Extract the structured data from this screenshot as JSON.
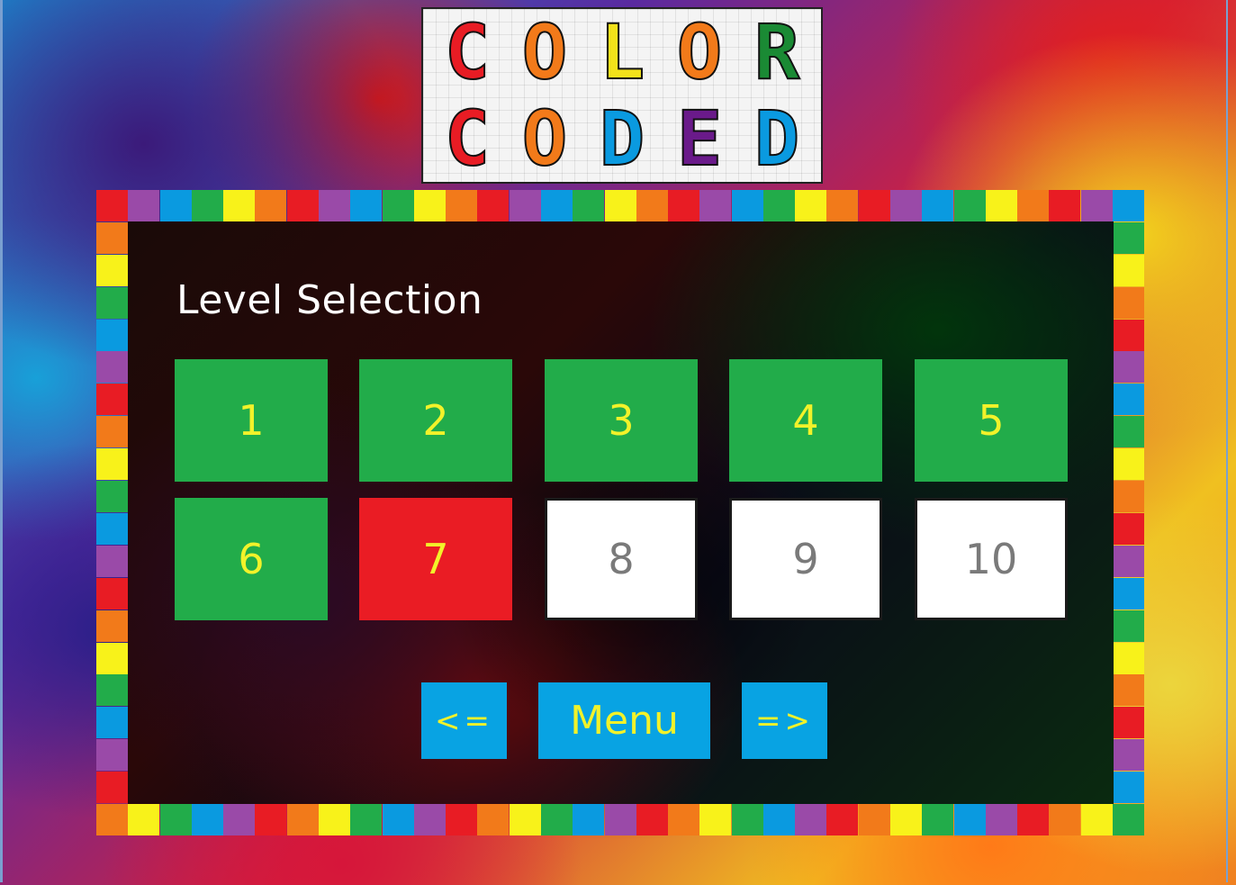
{
  "logo": {
    "row1": [
      {
        "letter": "C",
        "color": "#e81c24"
      },
      {
        "letter": "O",
        "color": "#f27a1a"
      },
      {
        "letter": "L",
        "color": "#f2e21a"
      },
      {
        "letter": "O",
        "color": "#f27a1a"
      },
      {
        "letter": "R",
        "color": "#1a8a34"
      }
    ],
    "row2": [
      {
        "letter": "C",
        "color": "#e81c24"
      },
      {
        "letter": "O",
        "color": "#f27a1a"
      },
      {
        "letter": "D",
        "color": "#0a9ae0"
      },
      {
        "letter": "E",
        "color": "#6a1a8a"
      },
      {
        "letter": "D",
        "color": "#0a9ae0"
      }
    ]
  },
  "panel": {
    "title": "Level Selection"
  },
  "levels": [
    {
      "label": "1",
      "status": "completed"
    },
    {
      "label": "2",
      "status": "completed"
    },
    {
      "label": "3",
      "status": "completed"
    },
    {
      "label": "4",
      "status": "completed"
    },
    {
      "label": "5",
      "status": "completed"
    },
    {
      "label": "6",
      "status": "completed"
    },
    {
      "label": "7",
      "status": "current"
    },
    {
      "label": "8",
      "status": "locked"
    },
    {
      "label": "9",
      "status": "locked"
    },
    {
      "label": "10",
      "status": "locked"
    }
  ],
  "nav": {
    "prev_label": "<=",
    "menu_label": "Menu",
    "next_label": "=>"
  },
  "colors": {
    "completed": "#22ac4a",
    "current": "#ea1c24",
    "locked": "#ffffff",
    "button_text": "#f2f22a",
    "nav_button": "#08a3e3"
  },
  "border_palette": [
    "#e81c24",
    "#9a4aa8",
    "#0a9ae0",
    "#22ac4a",
    "#f8f21a",
    "#f27a1a"
  ]
}
